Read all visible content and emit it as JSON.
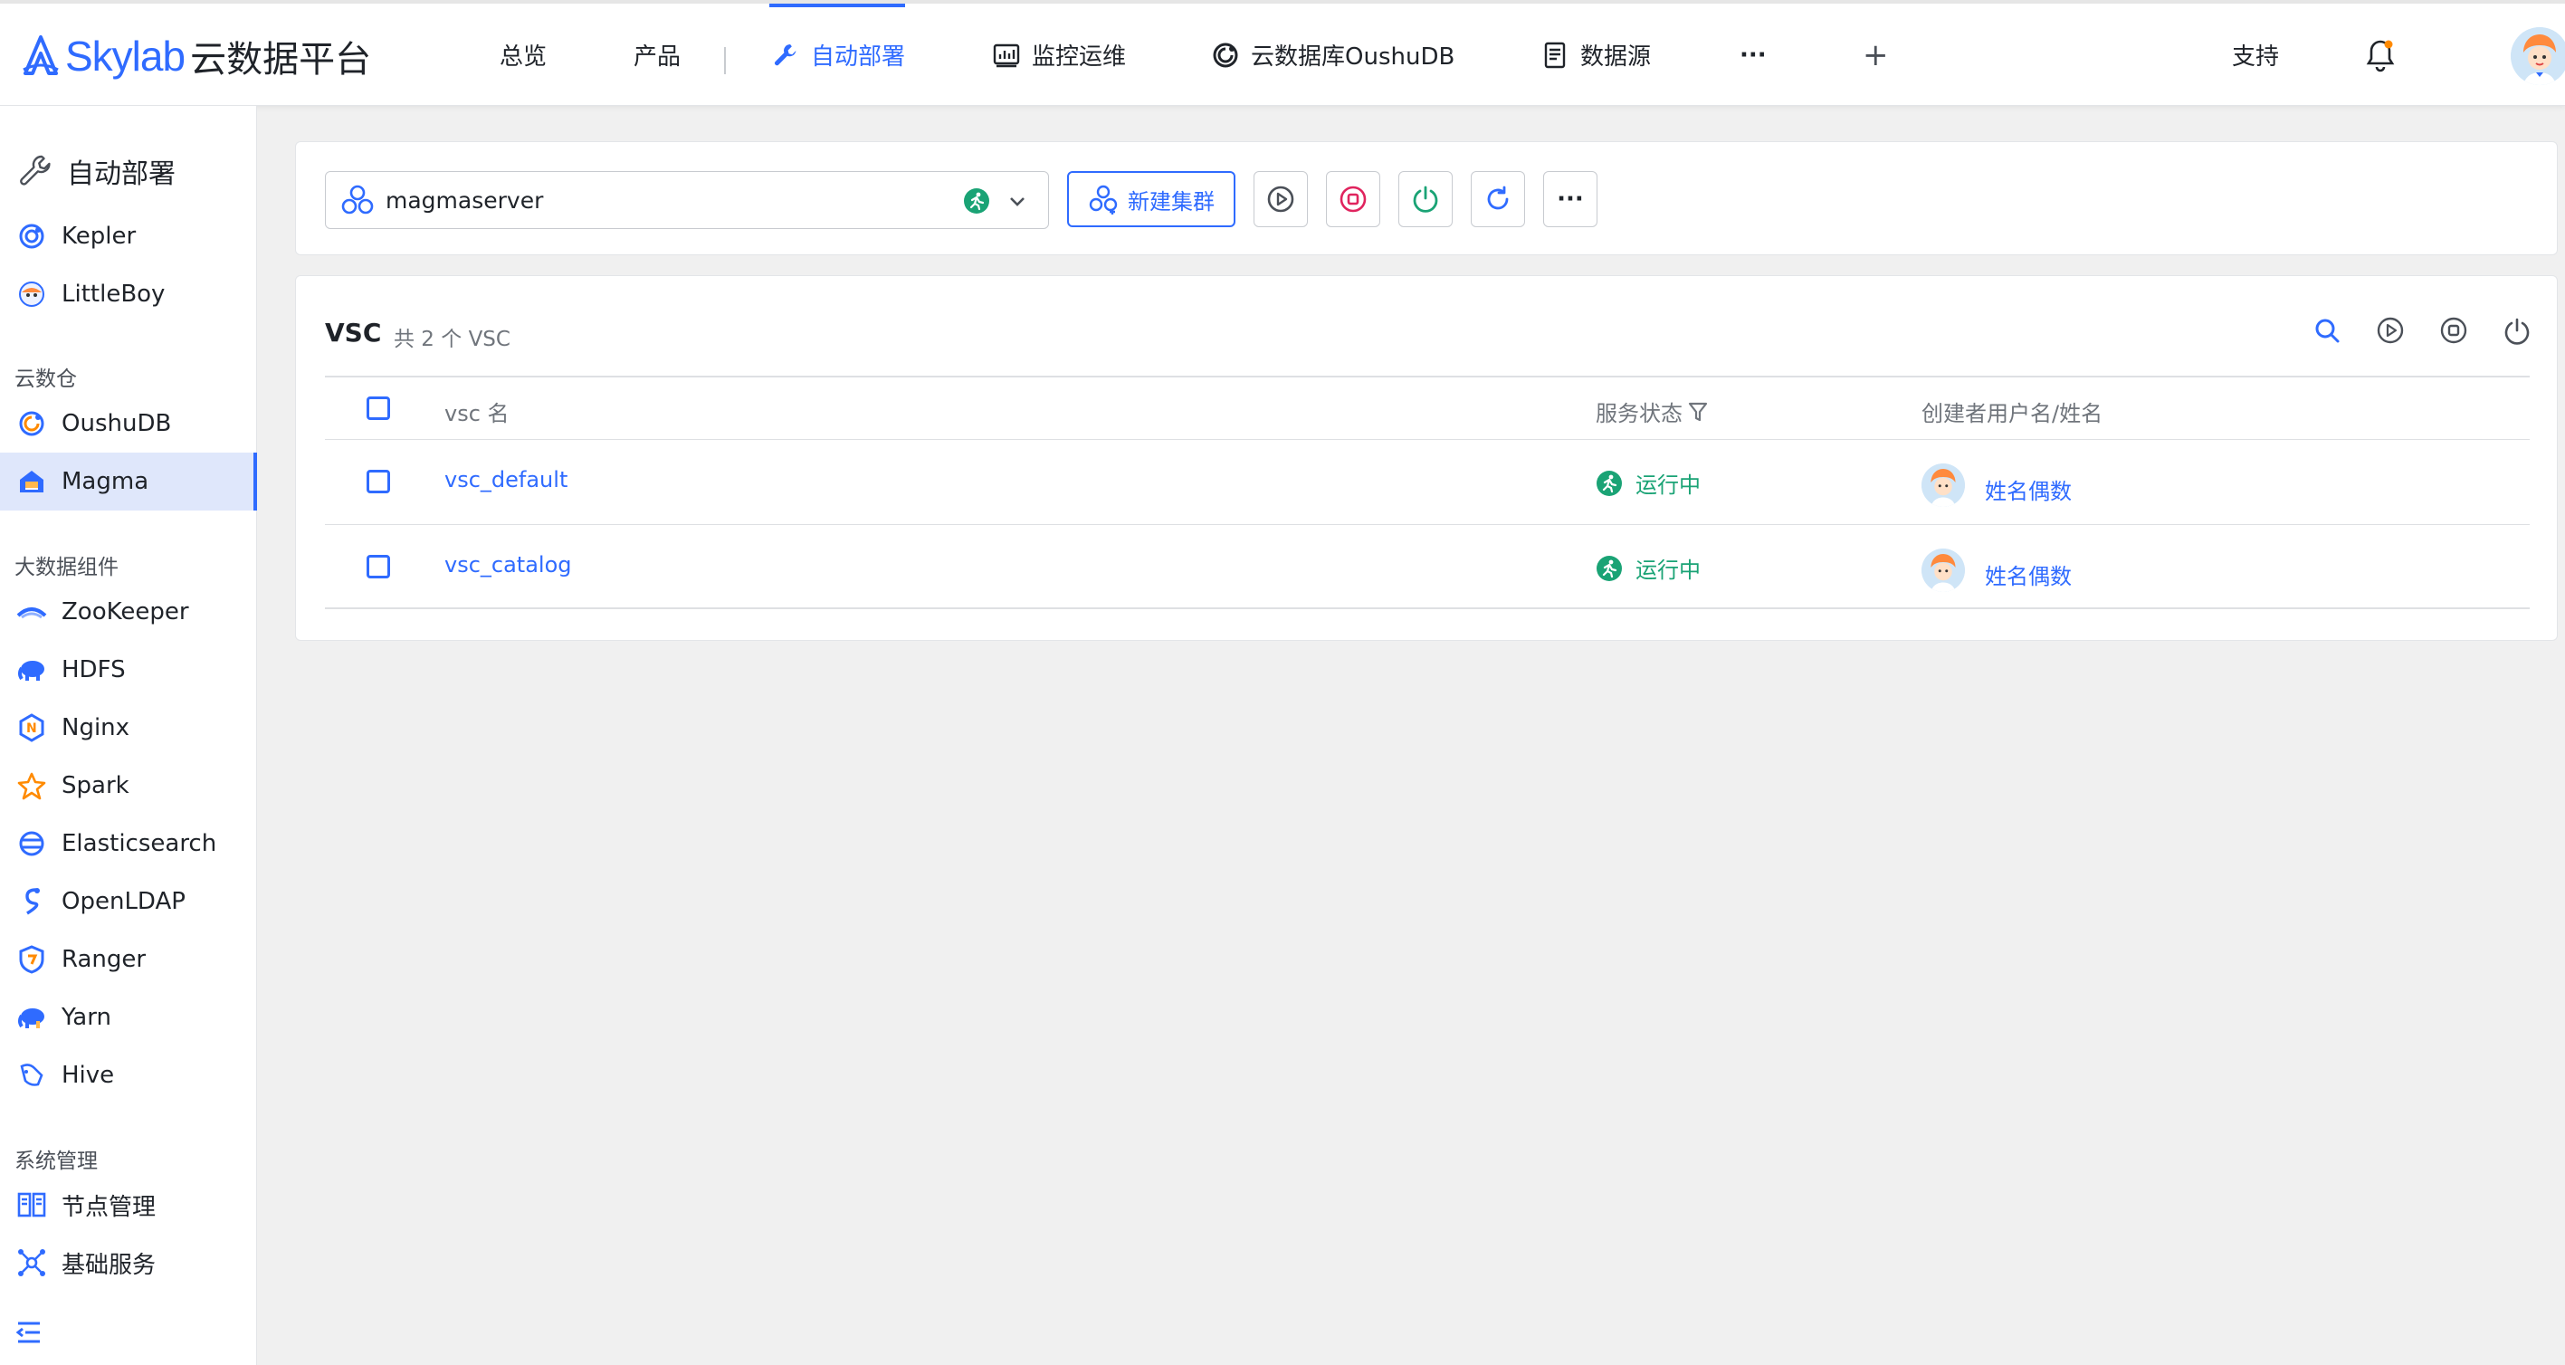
{
  "header": {
    "logo_text": "Skylab",
    "logo_suffix": "云数据平台",
    "nav": [
      {
        "label": "总览"
      },
      {
        "label": "产品"
      },
      {
        "label": "自动部署"
      },
      {
        "label": "监控运维"
      },
      {
        "label": "云数据库OushuDB"
      },
      {
        "label": "数据源"
      }
    ],
    "more_label": "···",
    "add_label": "+",
    "support_label": "支持"
  },
  "sidebar": {
    "title": "自动部署",
    "top_items": [
      {
        "label": "Kepler"
      },
      {
        "label": "LittleBoy"
      }
    ],
    "groups": [
      {
        "title": "云数仓",
        "items": [
          {
            "label": "OushuDB"
          },
          {
            "label": "Magma"
          }
        ]
      },
      {
        "title": "大数据组件",
        "items": [
          {
            "label": "ZooKeeper"
          },
          {
            "label": "HDFS"
          },
          {
            "label": "Nginx"
          },
          {
            "label": "Spark"
          },
          {
            "label": "Elasticsearch"
          },
          {
            "label": "OpenLDAP"
          },
          {
            "label": "Ranger"
          },
          {
            "label": "Yarn"
          },
          {
            "label": "Hive"
          }
        ]
      },
      {
        "title": "系统管理",
        "items": [
          {
            "label": "节点管理"
          },
          {
            "label": "基础服务"
          }
        ]
      }
    ],
    "active_item": "Magma"
  },
  "toolbar": {
    "cluster_value": "magmaserver",
    "new_cluster_label": "新建集群",
    "more_label": "···"
  },
  "vsc_table": {
    "title": "VSC",
    "count_text": "共 2 个 VSC",
    "columns": [
      "vsc 名",
      "服务状态",
      "创建者用户名/姓名"
    ],
    "rows": [
      {
        "name": "vsc_default",
        "status": "运行中",
        "owner": "姓名偶数"
      },
      {
        "name": "vsc_catalog",
        "status": "运行中",
        "owner": "姓名偶数"
      }
    ]
  },
  "colors": {
    "accent": "#2f6bff",
    "running": "#1aa375",
    "stop": "#e0245e",
    "power": "#1aa375",
    "active_bg": "#dfe7fb"
  }
}
